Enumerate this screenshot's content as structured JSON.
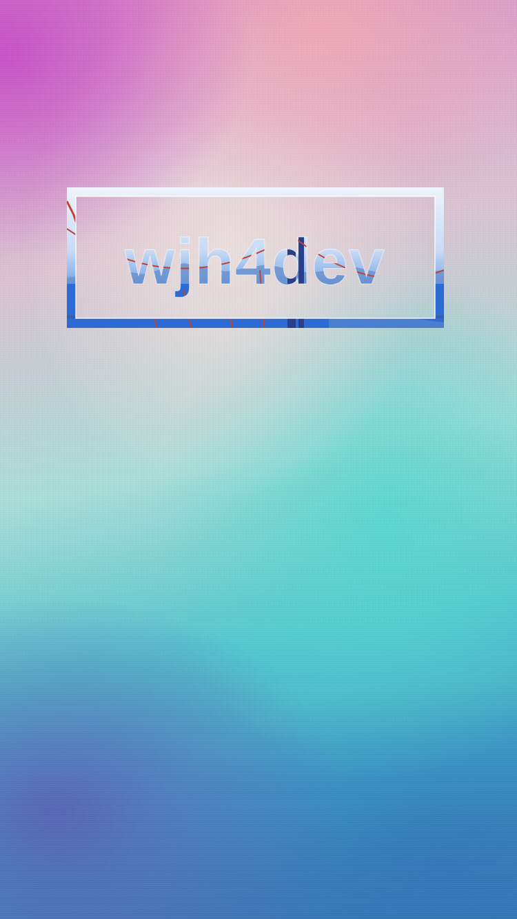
{
  "logo": {
    "text": "wjh4dev",
    "icon": "bridge-photo-fill"
  },
  "colors": {
    "sky_top": "#dfe9f6",
    "sky_mid": "#a9c6ee",
    "water": "#2f6fd6",
    "bridge": "#c0442f",
    "mountain": "#5d86c6"
  }
}
